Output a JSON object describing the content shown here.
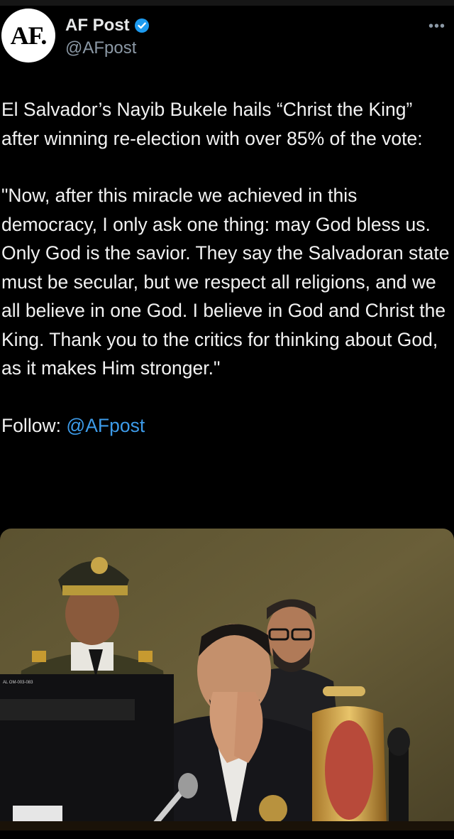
{
  "header": {
    "avatar_text": "AF.",
    "display_name": "AF Post",
    "handle": "@AFpost",
    "more_label": "•••"
  },
  "tweet": {
    "paragraph1": "El Salvador’s Nayib Bukele hails “Christ the King” after winning re-election with over 85% of the vote:",
    "paragraph2": "\"Now, after this miracle we achieved in this democracy, I only ask one thing: may God bless us. Only God is the savior. They say the Salvadoran state must be secular, but we respect all religions, and we all believe in one God. I believe in God and Christ the King. Thank you to the critics for thinking about God, as it makes Him stronger.\"",
    "follow_label": "Follow:",
    "follow_handle": "@AFpost"
  },
  "photo": {
    "sticker_text": "AL OM-003-083"
  },
  "colors": {
    "background": "#000000",
    "text": "#e7e9ea",
    "secondary": "#8b98a5",
    "link": "#3d9be9",
    "verified": "#1d9bf0"
  }
}
